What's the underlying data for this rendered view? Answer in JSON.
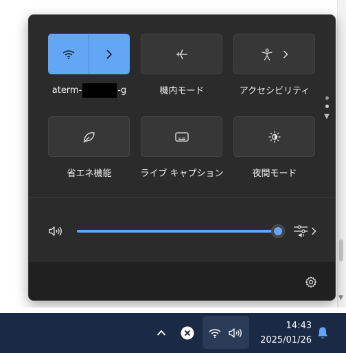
{
  "quick_settings": {
    "tiles": [
      {
        "id": "wifi",
        "label_prefix": "aterm-",
        "label_suffix": "-g",
        "active": true
      },
      {
        "id": "airplane",
        "label": "機内モード",
        "active": false
      },
      {
        "id": "accessibility",
        "label": "アクセシビリティ",
        "active": false
      },
      {
        "id": "energy-saver",
        "label": "省エネ機能",
        "active": false
      },
      {
        "id": "live-captions",
        "label": "ライブ キャプション",
        "active": false
      },
      {
        "id": "night-light",
        "label": "夜間モード",
        "active": false
      }
    ],
    "pager": {
      "pages": 2,
      "current": 1
    },
    "volume": {
      "level_percent": 100
    }
  },
  "taskbar": {
    "time": "14:43",
    "date": "2025/01/26"
  },
  "colors": {
    "accent": "#63a6f5",
    "panel_bg": "#2b2b2b",
    "tile_bg": "#373737",
    "taskbar_bg": "#1b2a44"
  }
}
